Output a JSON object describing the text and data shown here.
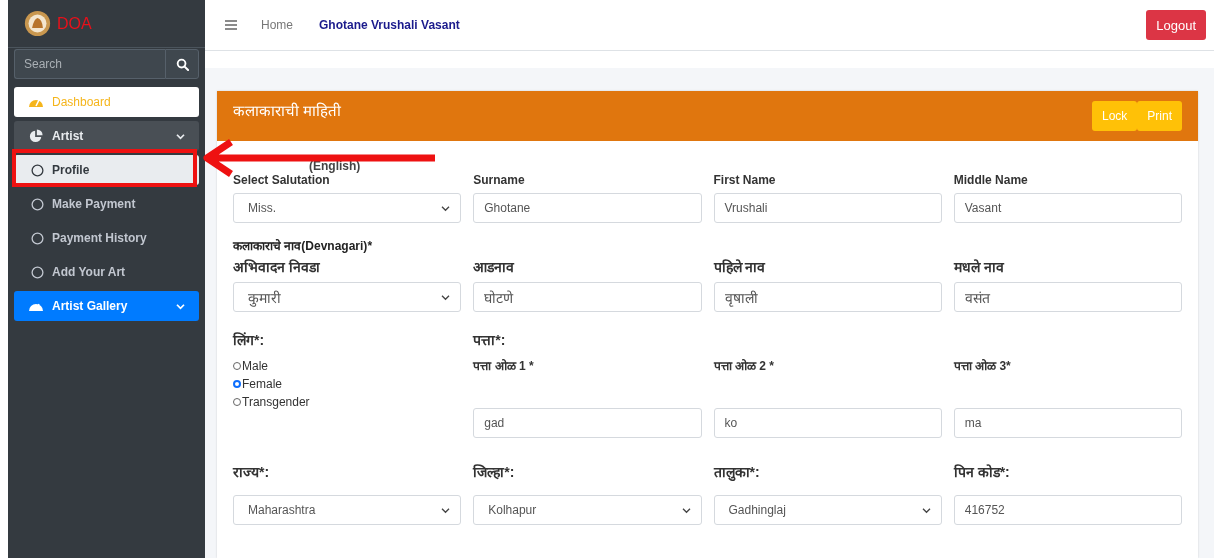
{
  "sidebar": {
    "brand": "DOA",
    "search": {
      "placeholder": "Search"
    },
    "items": [
      {
        "label": "Dashboard",
        "kind": "light"
      },
      {
        "label": "Artist",
        "kind": "group",
        "expanded": true,
        "children": [
          {
            "label": "Profile",
            "selected": true
          },
          {
            "label": "Make Payment",
            "selected": false
          },
          {
            "label": "Payment History",
            "selected": false
          },
          {
            "label": "Add Your Art",
            "selected": false
          }
        ]
      },
      {
        "label": "Artist Gallery",
        "kind": "primary"
      }
    ]
  },
  "topbar": {
    "home": "Home",
    "user": "Ghotane Vrushali Vasant",
    "logout": "Logout"
  },
  "callout": {
    "kind": "arrow-box"
  },
  "card": {
    "title": "कलाकाराची माहिती",
    "buttons": [
      "Lock",
      "Print"
    ],
    "english_heading": "(English)",
    "english_fields": [
      {
        "label": "Select Salutation",
        "value": "Miss.",
        "kind": "select"
      },
      {
        "label": "Surname",
        "value": "Ghotane",
        "kind": "input"
      },
      {
        "label": "First Name",
        "value": "Vrushali",
        "kind": "input"
      },
      {
        "label": "Middle Name",
        "value": "Vasant",
        "kind": "input"
      }
    ],
    "devnagari_heading": "कलाकाराचे नाव**(Devnagari)***",
    "devnagari_fields": [
      {
        "label": "अभिवादन निवडा",
        "value": "कुमारी",
        "kind": "select"
      },
      {
        "label": "आडनाव",
        "value": "घोटणे",
        "kind": "input"
      },
      {
        "label": "पहिले नाव",
        "value": "वृषाली",
        "kind": "input"
      },
      {
        "label": "मधले नाव",
        "value": "वसंत",
        "kind": "input"
      }
    ],
    "gender": {
      "label": "लिंग*:",
      "options": [
        {
          "label": "Male",
          "selected": false
        },
        {
          "label": "Female",
          "selected": true
        },
        {
          "label": "Transgender",
          "selected": false
        }
      ]
    },
    "address": {
      "label": "पत्ता*:",
      "fields": [
        {
          "label": "पत्ता ओळ 1 *",
          "value": "gad"
        },
        {
          "label": "पत्ता ओळ 2 *",
          "value": "ko"
        },
        {
          "label": "पत्ता ओळ 3*",
          "value": "ma"
        }
      ]
    },
    "location_fields": [
      {
        "label": "राज्य*:",
        "value": "Maharashtra",
        "kind": "select"
      },
      {
        "label": "जिल्हा*:",
        "value": "Kolhapur",
        "kind": "select"
      },
      {
        "label": "तालुका*:",
        "value": "Gadhinglaj",
        "kind": "select"
      },
      {
        "label": "पिन कोड*:",
        "value": "416752",
        "kind": "input"
      }
    ]
  }
}
